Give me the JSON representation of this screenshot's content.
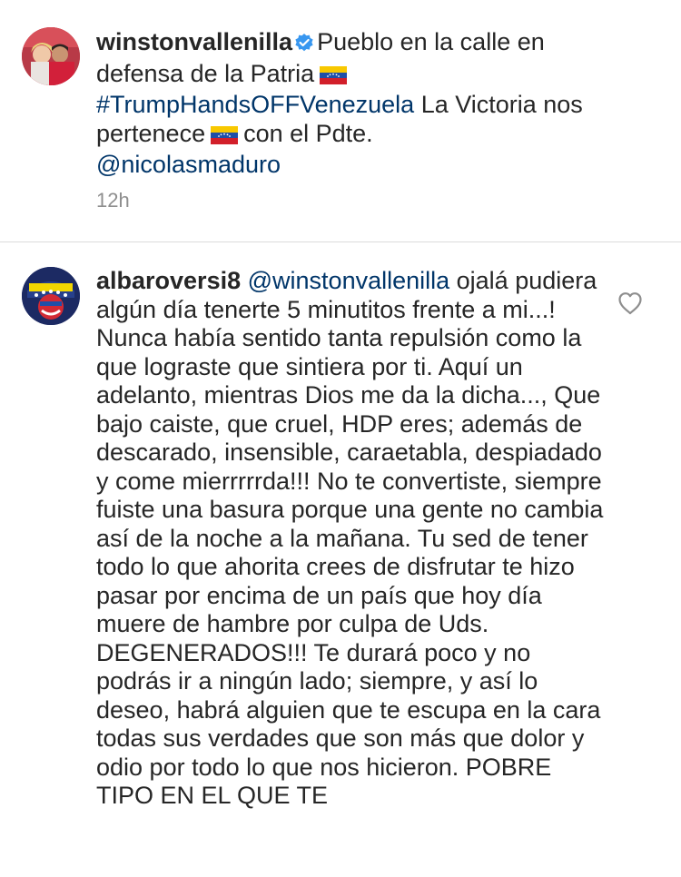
{
  "post": {
    "username": "winstonvallenilla",
    "caption_1": "Pueblo en la calle en defensa de la Patria",
    "hashtag": "#TrumpHandsOFFVenezuela",
    "caption_2": "La Victoria nos pertenece",
    "caption_3": "con el Pdte.",
    "mention": "@nicolasmaduro",
    "time": "12h",
    "flag_icon": "venezuela-flag-icon",
    "verified_icon": "verified-badge-icon",
    "accent_color": "#3897f0",
    "link_color": "#003569"
  },
  "comment": {
    "username": "albaroversi8",
    "mention": "@winstonvallenilla",
    "text": "ojalá pudiera algún día tenerte 5 minutitos frente a mi...! Nunca había sentido tanta repulsión como la que lograste que sintiera por ti. Aquí un adelanto, mientras Dios me da la dicha..., Que bajo caiste, que cruel, HDP eres; además de descarado, insensible, caraetabla, despiadado y come mierrrrrda!!! No te convertiste, siempre fuiste una basura porque una gente no cambia así de la noche a la mañana. Tu sed de tener todo lo que ahorita crees de disfrutar te hizo pasar por encima de un país que hoy día muere de hambre por culpa de Uds. DEGENERADOS!!! Te durará poco y no podrás ir a ningún lado; siempre, y así lo deseo, habrá alguien que te escupa en la cara todas sus verdades que son más que dolor y odio por todo lo que nos hicieron. POBRE TIPO EN EL QUE TE",
    "like_icon": "heart-outline-icon"
  }
}
